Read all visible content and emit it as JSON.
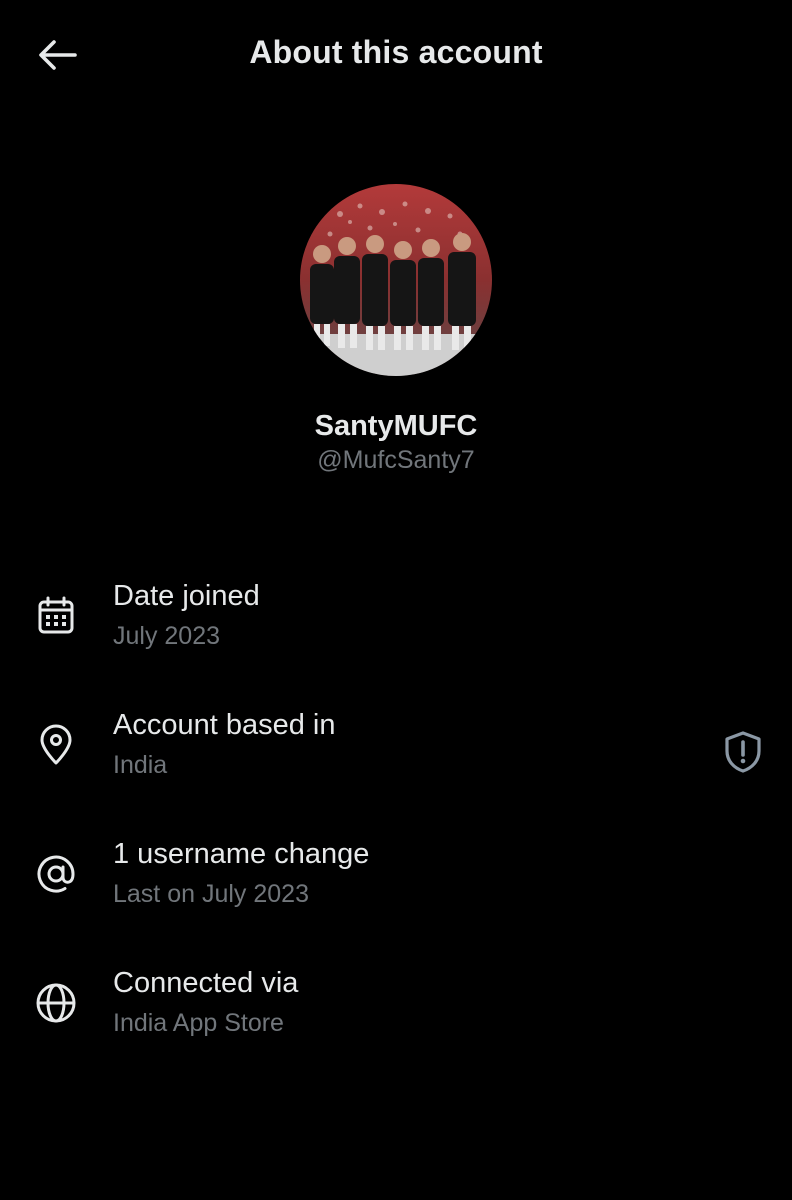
{
  "header": {
    "title": "About this account",
    "back_icon": "arrow-left-icon"
  },
  "profile": {
    "display_name": "SantyMUFC",
    "handle": "@MufcSanty7",
    "avatar_description_icon": "avatar-image"
  },
  "details": [
    {
      "icon": "calendar-icon",
      "label": "Date joined",
      "value": "July 2023"
    },
    {
      "icon": "location-pin-icon",
      "label": "Account based in",
      "value": "India",
      "extra_icon": "shield-alert-icon"
    },
    {
      "icon": "at-sign-icon",
      "label": "1 username change",
      "value": "Last on July 2023"
    },
    {
      "icon": "globe-icon",
      "label": "Connected via",
      "value": "India App Store"
    }
  ],
  "colors": {
    "background": "#000000",
    "primary_text": "#e7e9ea",
    "secondary_text": "#71767b"
  }
}
